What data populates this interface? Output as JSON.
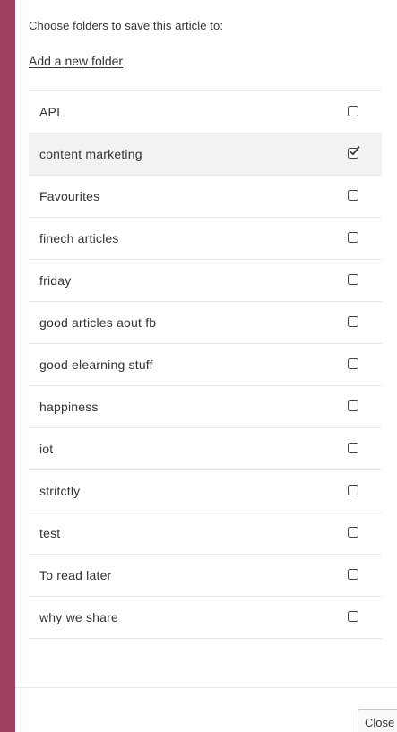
{
  "dialog": {
    "prompt": "Choose folders to save this article to:",
    "add_folder_link": "Add a new folder",
    "close_label": "Close"
  },
  "folders": [
    {
      "name": "API",
      "checked": false
    },
    {
      "name": "content marketing",
      "checked": true
    },
    {
      "name": "Favourites",
      "checked": false
    },
    {
      "name": "finech articles",
      "checked": false
    },
    {
      "name": "friday",
      "checked": false
    },
    {
      "name": "good articles aout fb",
      "checked": false
    },
    {
      "name": "good elearning stuff",
      "checked": false
    },
    {
      "name": "happiness",
      "checked": false
    },
    {
      "name": "iot",
      "checked": false
    },
    {
      "name": "stritctly",
      "checked": false
    },
    {
      "name": "test",
      "checked": false
    },
    {
      "name": "To read later",
      "checked": false
    },
    {
      "name": "why we share",
      "checked": false
    }
  ],
  "colors": {
    "page_background": "#a0405e",
    "dialog_background": "#ffffff",
    "selected_row": "#f2f2f2",
    "text": "#333333"
  },
  "icons": {
    "checkbox": "checkbox-icon",
    "checkmark": "checkmark-icon"
  }
}
